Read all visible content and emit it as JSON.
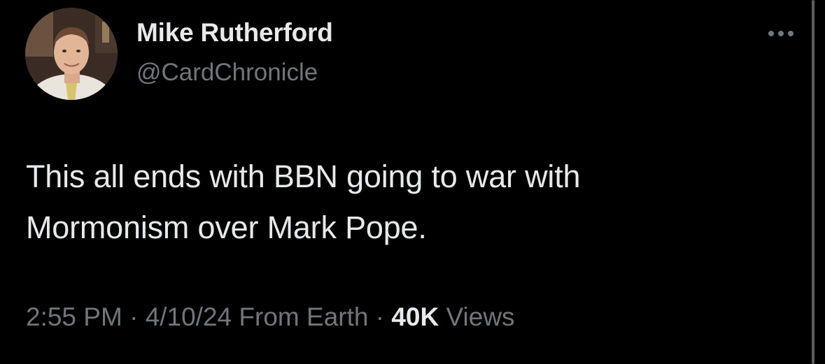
{
  "author": {
    "display_name": "Mike Rutherford",
    "handle": "@CardChronicle",
    "avatar_icon": "profile-photo"
  },
  "more_menu": {
    "icon": "more-horizontal-icon"
  },
  "tweet": {
    "text_lines": [
      "This all ends with BBN going to war with",
      "Mormonism over Mark Pope."
    ]
  },
  "meta": {
    "time": "2:55 PM",
    "separator": "·",
    "date": "4/10/24",
    "source": "From Earth",
    "views_count": "40K",
    "views_label": "Views"
  },
  "colors": {
    "background": "#000000",
    "primary_text": "#e7e9ea",
    "secondary_text": "#71767b"
  }
}
